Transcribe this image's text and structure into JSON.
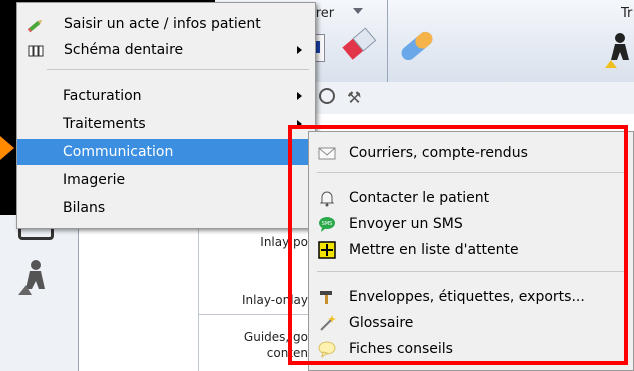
{
  "toolbar": {
    "facturer_label": "Facturer",
    "right_label": "Tr"
  },
  "table": {
    "rows": [
      "Inlay po",
      "Inlay-onlay",
      "Guides, go",
      "conten"
    ]
  },
  "menu": {
    "items": [
      {
        "label": "Saisir un acte / infos patient",
        "icon": "pencil-icon",
        "submenu": false
      },
      {
        "label": "Schéma dentaire",
        "icon": "teeth-chart-icon",
        "submenu": true
      },
      {
        "label": "Facturation",
        "submenu": true
      },
      {
        "label": "Traitements",
        "submenu": true
      },
      {
        "label": "Communication",
        "submenu": true,
        "highlighted": true
      },
      {
        "label": "Imagerie",
        "submenu": false
      },
      {
        "label": "Bilans",
        "submenu": false
      }
    ]
  },
  "submenu": {
    "items": [
      {
        "label": "Courriers, compte-rendus",
        "icon": "envelope-icon"
      },
      {
        "label": "Contacter le patient",
        "icon": "bell-icon"
      },
      {
        "label": "Envoyer un SMS",
        "icon": "sms-icon"
      },
      {
        "label": "Mettre en liste d'attente",
        "icon": "plus-box-icon"
      },
      {
        "label": "Enveloppes, étiquettes, exports...",
        "icon": "tools-icon"
      },
      {
        "label": "Glossaire",
        "icon": "magic-wand-icon"
      },
      {
        "label": "Fiches conseils",
        "icon": "speech-bubble-icon"
      }
    ]
  },
  "colors": {
    "highlight": "#3c8fe0",
    "red_box": "#ff0000",
    "pointer": "#ff8a00",
    "cyan_cell": "#12e8ef"
  }
}
